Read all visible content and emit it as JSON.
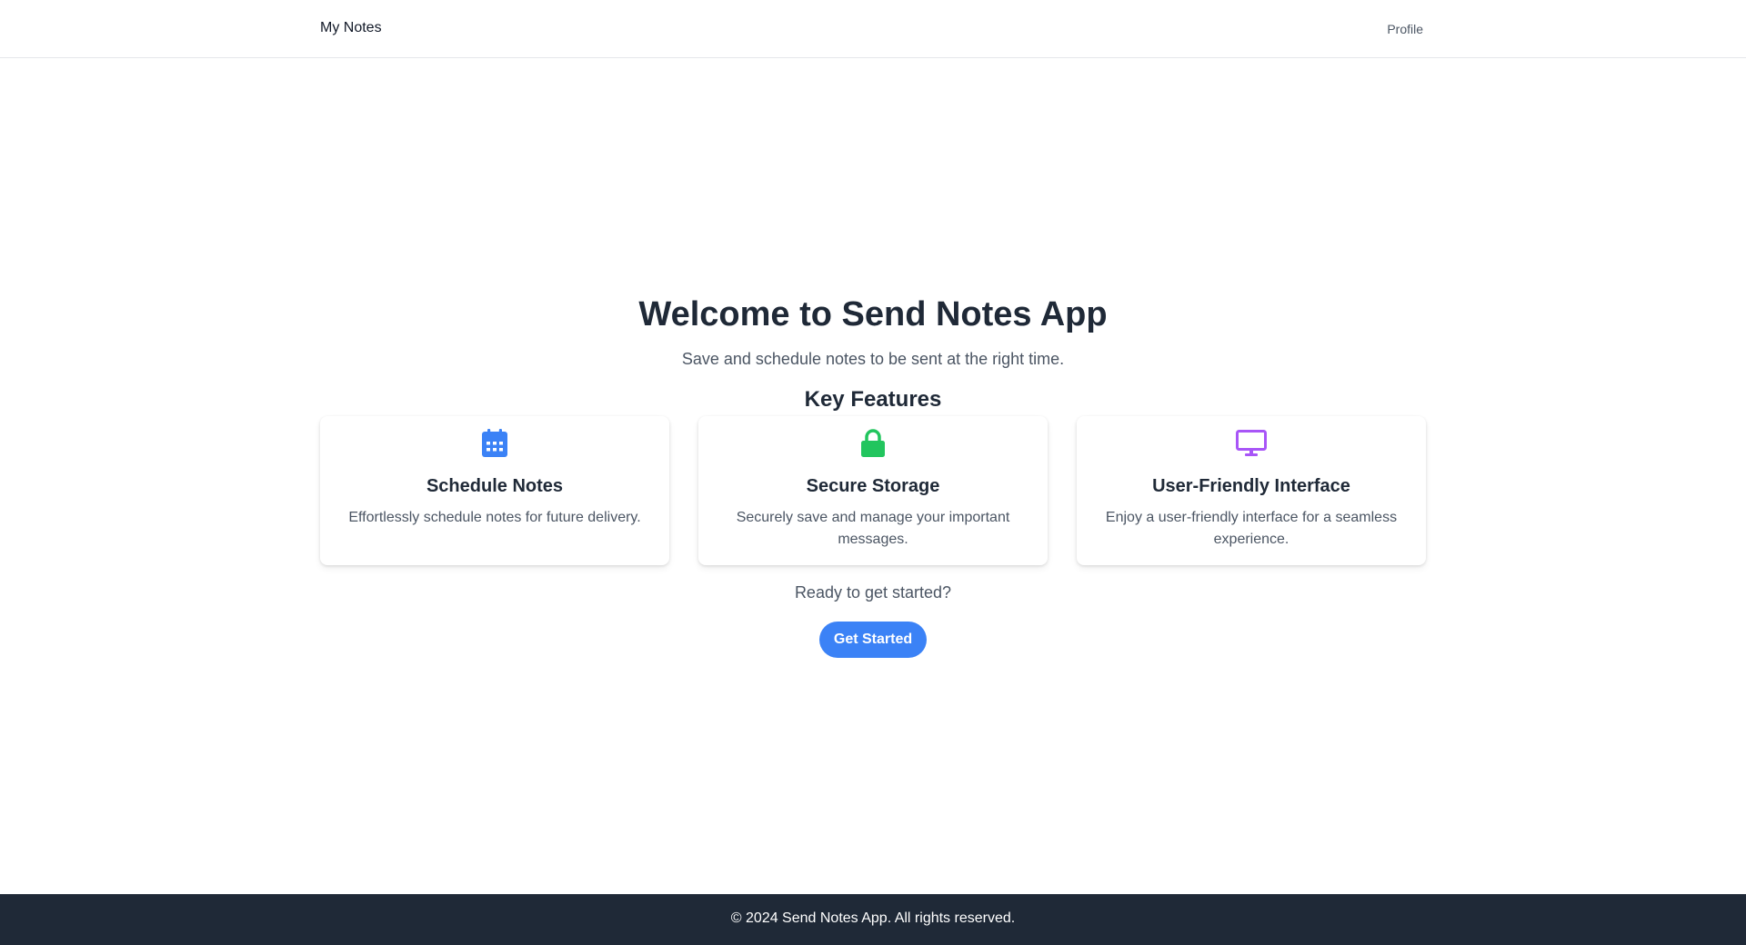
{
  "header": {
    "brand": "My Notes",
    "profile_link": "Profile"
  },
  "hero": {
    "title": "Welcome to Send Notes App",
    "subtitle": "Save and schedule notes to be sent at the right time.",
    "features_heading": "Key Features"
  },
  "features": [
    {
      "icon": "calendar-icon",
      "icon_color": "#3b82f6",
      "title": "Schedule Notes",
      "description": "Effortlessly schedule notes for future delivery."
    },
    {
      "icon": "lock-icon",
      "icon_color": "#22c55e",
      "title": "Secure Storage",
      "description": "Securely save and manage your important messages."
    },
    {
      "icon": "desktop-icon",
      "icon_color": "#a855f7",
      "title": "User-Friendly Interface",
      "description": "Enjoy a user-friendly interface for a seamless experience."
    }
  ],
  "cta": {
    "prompt": "Ready to get started?",
    "button_label": "Get Started",
    "button_color": "#3b82f6"
  },
  "footer": {
    "copyright": "© 2024 Send Notes App. All rights reserved."
  }
}
